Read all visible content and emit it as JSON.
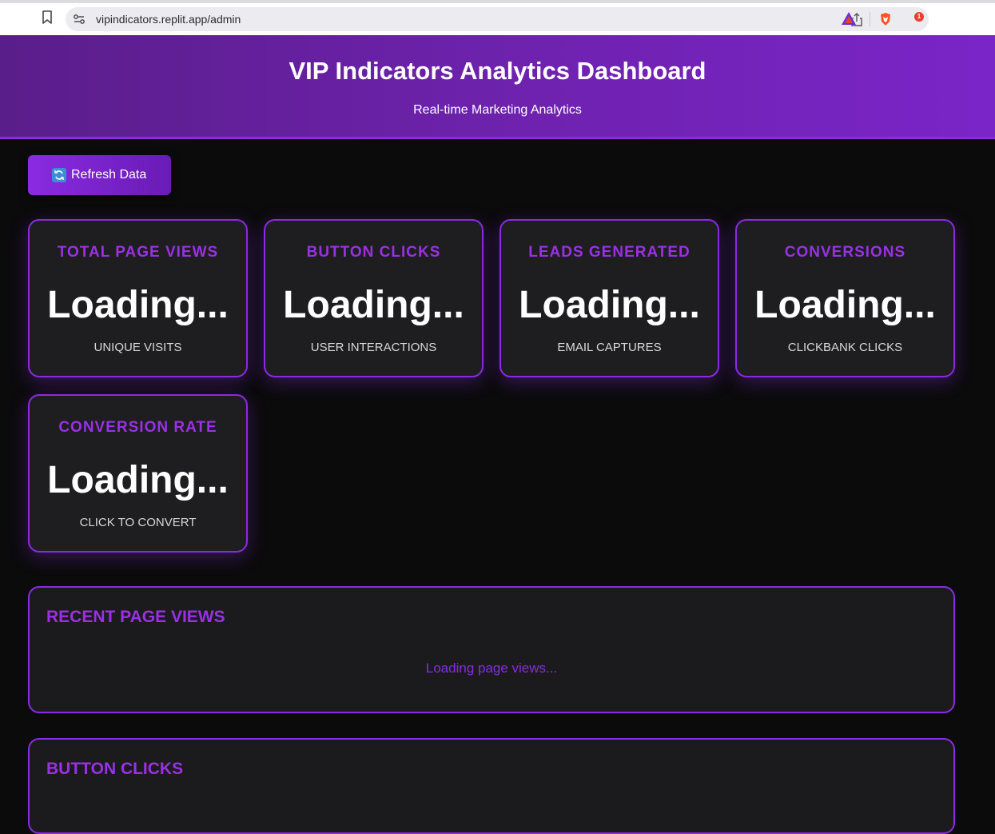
{
  "browser": {
    "url": "vipindicators.replit.app/admin",
    "rewards_badge": "1"
  },
  "header": {
    "title": "VIP Indicators Analytics Dashboard",
    "subtitle": "Real-time Marketing Analytics"
  },
  "toolbar": {
    "refresh_label": "Refresh Data"
  },
  "stats": [
    {
      "label": "TOTAL PAGE VIEWS",
      "value": "Loading...",
      "desc": "UNIQUE VISITS"
    },
    {
      "label": "BUTTON CLICKS",
      "value": "Loading...",
      "desc": "USER INTERACTIONS"
    },
    {
      "label": "LEADS GENERATED",
      "value": "Loading...",
      "desc": "EMAIL CAPTURES"
    },
    {
      "label": "CONVERSIONS",
      "value": "Loading...",
      "desc": "CLICKBANK CLICKS"
    },
    {
      "label": "CONVERSION RATE",
      "value": "Loading...",
      "desc": "CLICK TO CONVERT"
    }
  ],
  "sections": {
    "page_views": {
      "title": "RECENT PAGE VIEWS",
      "loading": "Loading page views..."
    },
    "button_clicks": {
      "title": "BUTTON CLICKS"
    }
  },
  "colors": {
    "accent": "#8a2be2",
    "background": "#0b0b0c",
    "card": "#1e1e20"
  }
}
